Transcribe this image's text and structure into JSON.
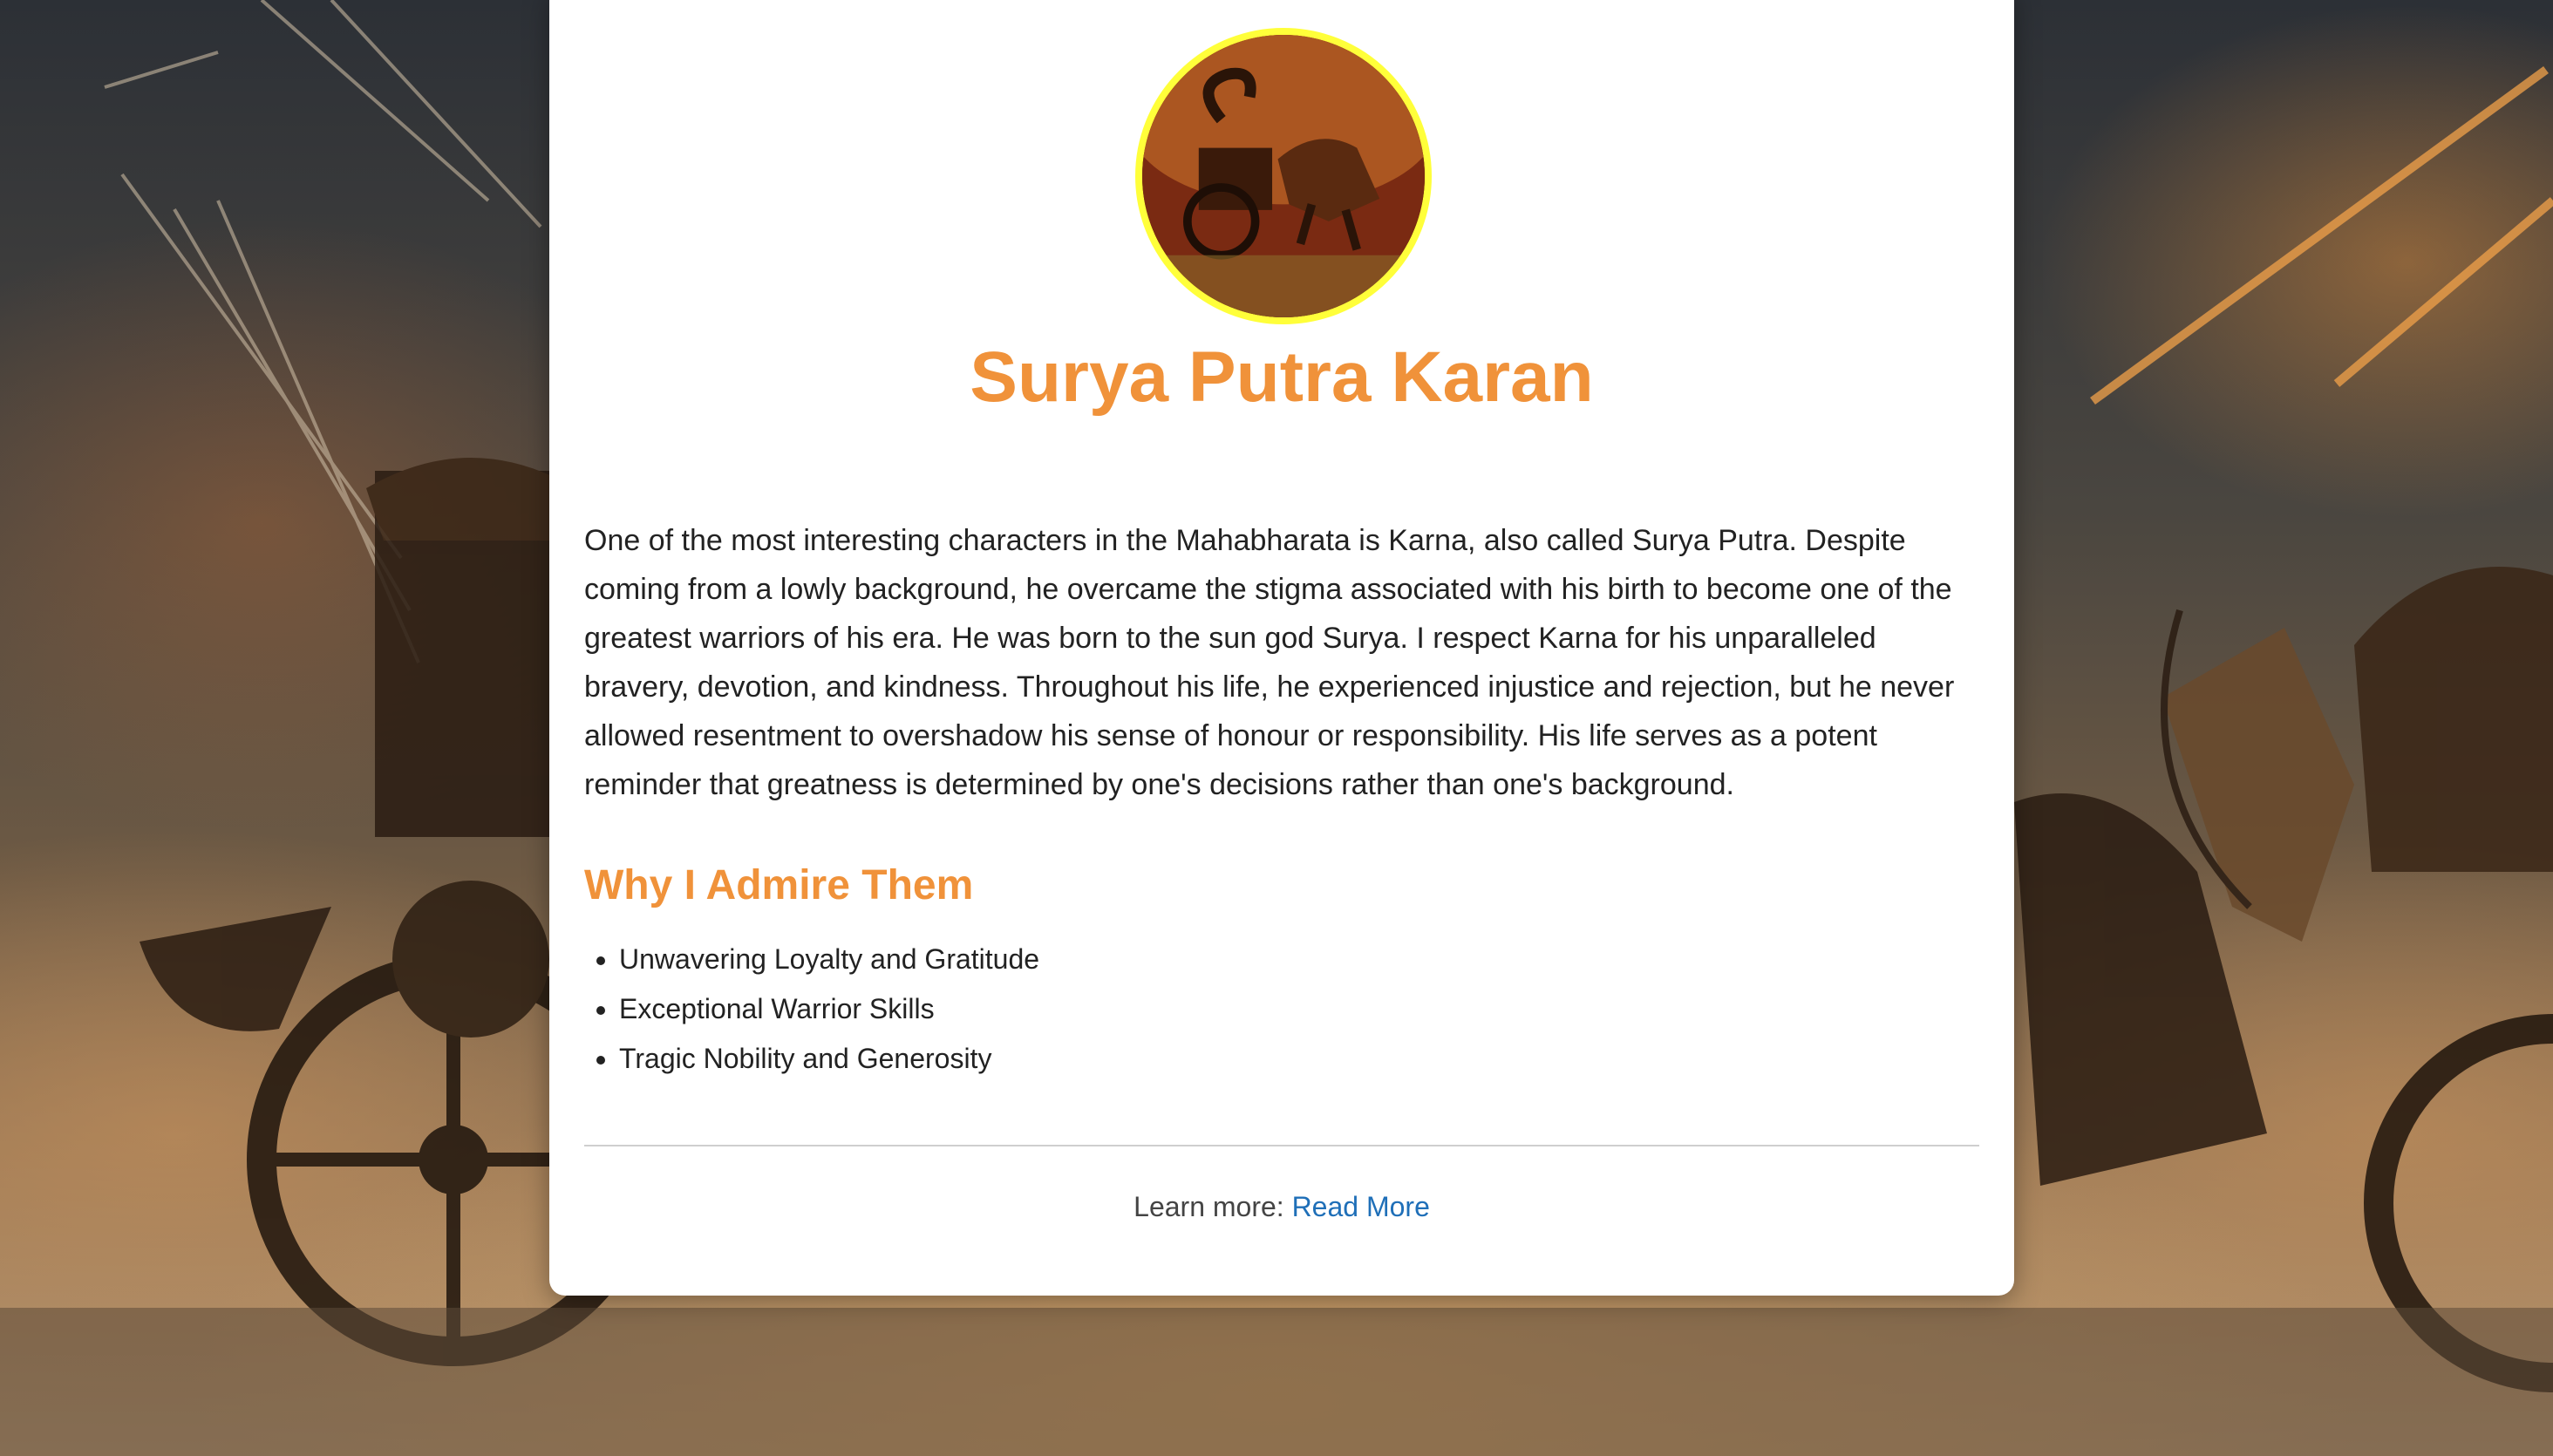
{
  "profile": {
    "name": "Surya Putra Karan",
    "avatar_alt": "Karna on his chariot"
  },
  "bio": {
    "text": "One of the most interesting characters in the Mahabharata is Karna, also called Surya Putra. Despite coming from a lowly background, he overcame the stigma associated with his birth to become one of the greatest warriors of his era. He was born to the sun god Surya. I respect Karna for his unparalleled bravery, devotion, and kindness. Throughout his life, he experienced injustice and rejection, but he never allowed resentment to overshadow his sense of honour or responsibility. His life serves as a potent reminder that greatness is determined by one's decisions rather than one's background."
  },
  "admire": {
    "heading": "Why I Admire Them",
    "items": [
      "Unwavering Loyalty and Gratitude",
      "Exceptional Warrior Skills",
      "Tragic Nobility and Generosity"
    ]
  },
  "footer": {
    "prefix": "Learn more: ",
    "link_label": "Read More"
  },
  "colors": {
    "accent": "#f0923a",
    "avatar_border": "#ffff3a",
    "link": "#1f6fb8"
  }
}
